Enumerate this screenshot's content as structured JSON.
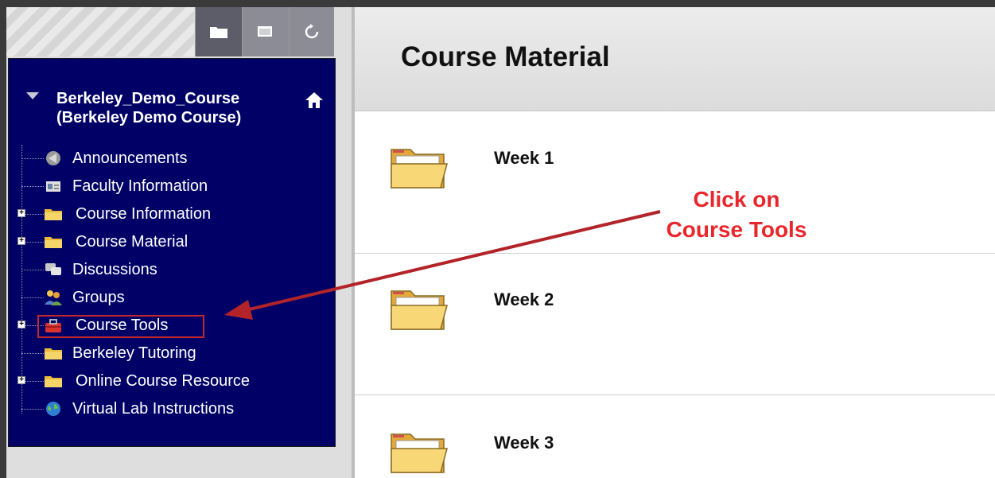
{
  "sidebar": {
    "course_title_line1": "Berkeley_Demo_Course",
    "course_title_line2": "(Berkeley Demo Course)",
    "toolbar": [
      "folder-view-icon",
      "window-view-icon",
      "refresh-icon"
    ],
    "items": [
      {
        "label": "Announcements",
        "icon": "announcements-icon",
        "expandable": false
      },
      {
        "label": "Faculty Information",
        "icon": "faculty-card-icon",
        "expandable": false
      },
      {
        "label": "Course Information",
        "icon": "folder-icon",
        "expandable": true
      },
      {
        "label": "Course Material",
        "icon": "folder-icon",
        "expandable": true
      },
      {
        "label": "Discussions",
        "icon": "discussions-icon",
        "expandable": false
      },
      {
        "label": "Groups",
        "icon": "groups-icon",
        "expandable": false
      },
      {
        "label": "Course Tools",
        "icon": "toolbox-icon",
        "expandable": true,
        "highlighted": true
      },
      {
        "label": "Berkeley Tutoring",
        "icon": "folder-icon",
        "expandable": false
      },
      {
        "label": "Online Course Resource",
        "icon": "folder-icon",
        "expandable": true
      },
      {
        "label": "Virtual Lab Instructions",
        "icon": "globe-icon",
        "expandable": false
      }
    ]
  },
  "main": {
    "title": "Course Material",
    "weeks": [
      "Week 1",
      "Week 2",
      "Week 3"
    ]
  },
  "annotation": {
    "line1": "Click on",
    "line2": "Course Tools",
    "color": "#e8262b"
  },
  "colors": {
    "menu_bg": "#000066",
    "highlight": "#c0282e"
  }
}
